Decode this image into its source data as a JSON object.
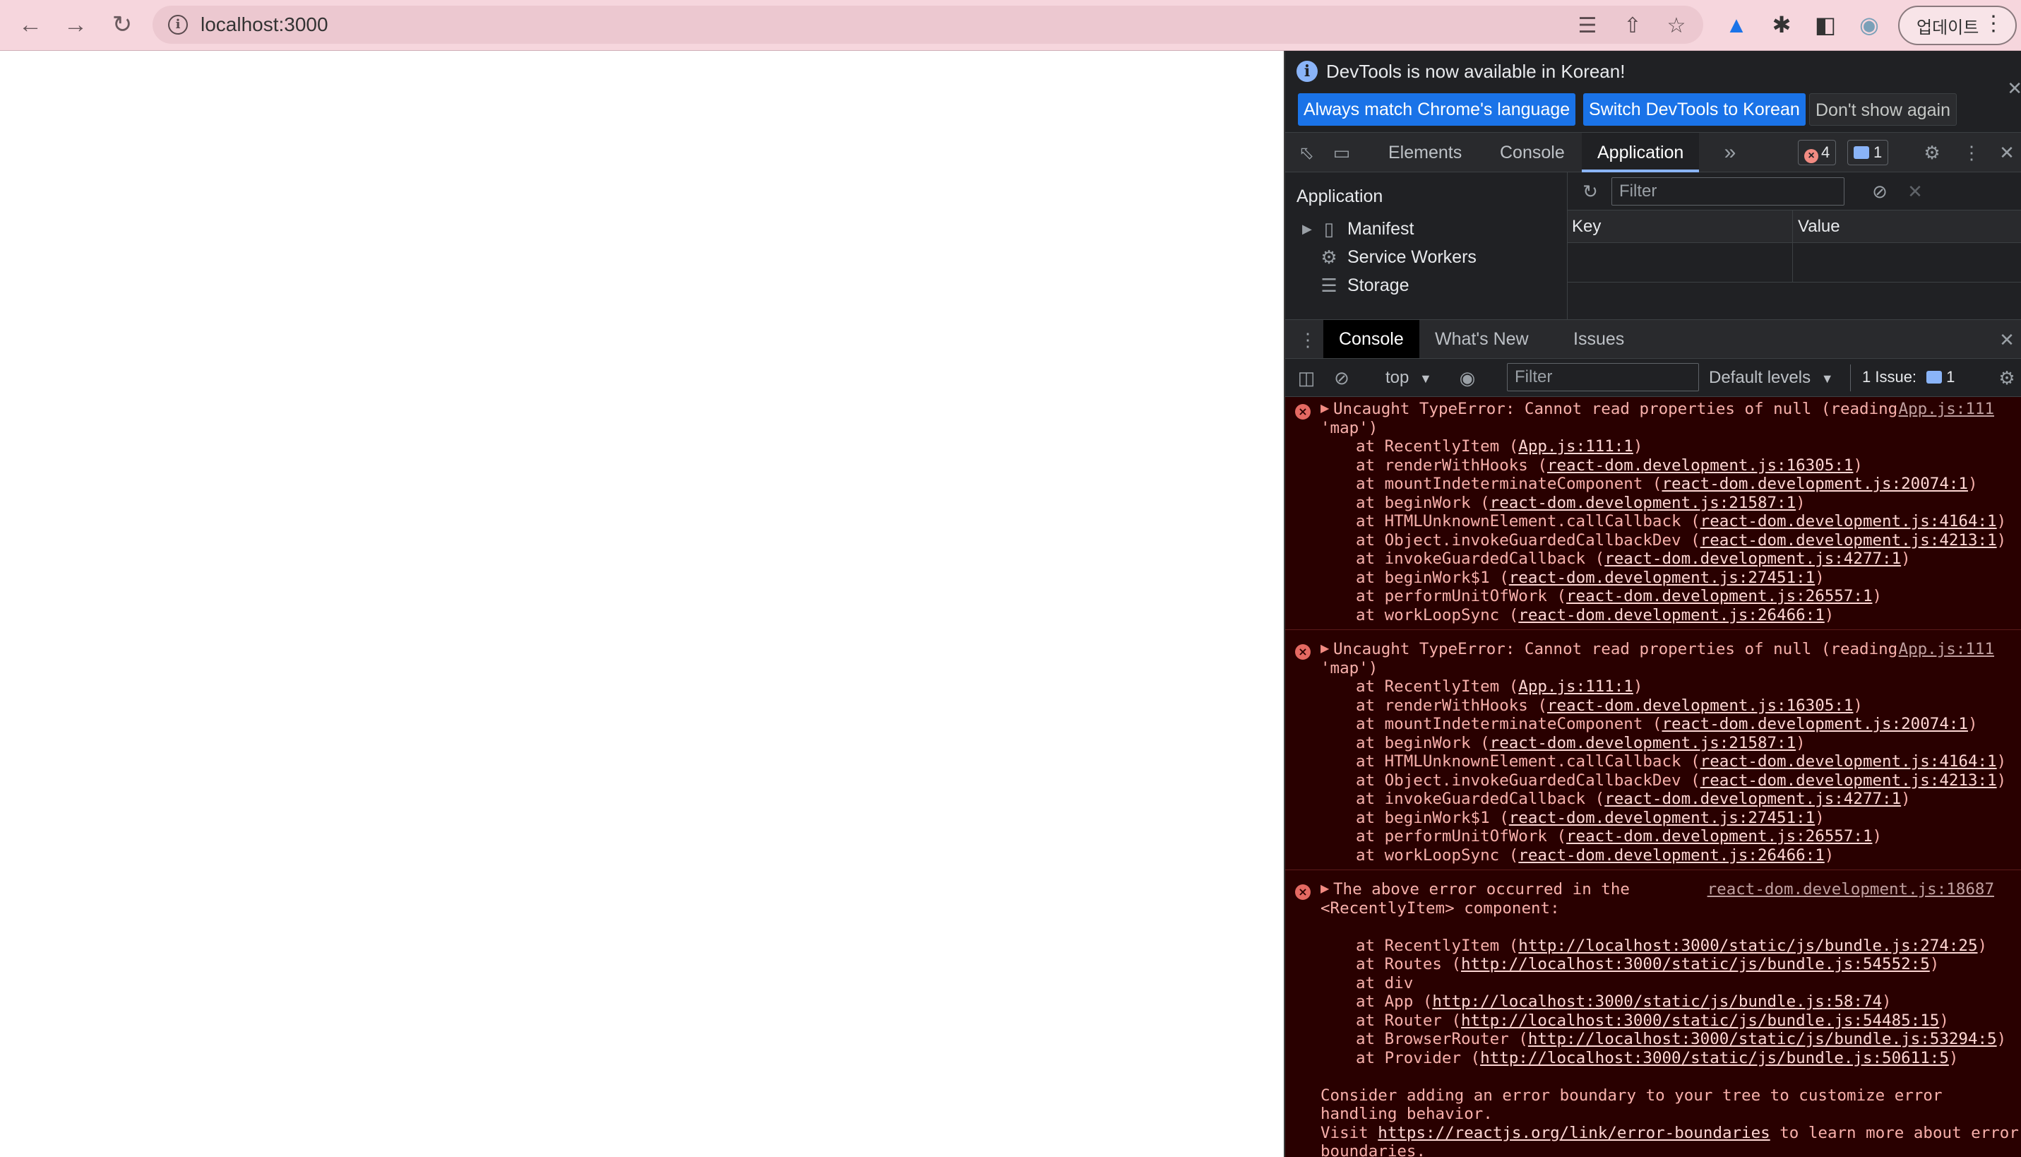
{
  "browser": {
    "url": "localhost:3000",
    "update_label": "업데이트"
  },
  "devtools": {
    "infobar": {
      "message": "DevTools is now available in Korean!",
      "btn_match": "Always match Chrome's language",
      "btn_switch": "Switch DevTools to Korean",
      "btn_dismiss": "Don't show again"
    },
    "tabs": [
      "Elements",
      "Console",
      "Application"
    ],
    "more_tabs": "»",
    "error_count": "4",
    "message_count": "1",
    "application": {
      "title": "Application",
      "items": [
        "Manifest",
        "Service Workers",
        "Storage"
      ],
      "filter_placeholder": "Filter",
      "col_key": "Key",
      "col_value": "Value"
    },
    "drawer_tabs": [
      "Console",
      "What's New",
      "Issues"
    ],
    "console_toolbar": {
      "context": "top",
      "filter_placeholder": "Filter",
      "levels": "Default levels",
      "issues_label": "1 Issue:",
      "issues_count": "1"
    },
    "messages": [
      {
        "head": "Uncaught TypeError: Cannot read properties of null (reading",
        "head2": "'map')",
        "source": "App.js:111",
        "stack": [
          {
            "fn": "RecentlyItem",
            "loc": "App.js:111:1"
          },
          {
            "fn": "renderWithHooks",
            "loc": "react-dom.development.js:16305:1"
          },
          {
            "fn": "mountIndeterminateComponent",
            "loc": "react-dom.development.js:20074:1"
          },
          {
            "fn": "beginWork",
            "loc": "react-dom.development.js:21587:1"
          },
          {
            "fn": "HTMLUnknownElement.callCallback",
            "loc": "react-dom.development.js:4164:1"
          },
          {
            "fn": "Object.invokeGuardedCallbackDev",
            "loc": "react-dom.development.js:4213:1"
          },
          {
            "fn": "invokeGuardedCallback",
            "loc": "react-dom.development.js:4277:1"
          },
          {
            "fn": "beginWork$1",
            "loc": "react-dom.development.js:27451:1"
          },
          {
            "fn": "performUnitOfWork",
            "loc": "react-dom.development.js:26557:1"
          },
          {
            "fn": "workLoopSync",
            "loc": "react-dom.development.js:26466:1"
          }
        ]
      },
      {
        "head": "Uncaught TypeError: Cannot read properties of null (reading",
        "head2": "'map')",
        "source": "App.js:111",
        "stack": [
          {
            "fn": "RecentlyItem",
            "loc": "App.js:111:1"
          },
          {
            "fn": "renderWithHooks",
            "loc": "react-dom.development.js:16305:1"
          },
          {
            "fn": "mountIndeterminateComponent",
            "loc": "react-dom.development.js:20074:1"
          },
          {
            "fn": "beginWork",
            "loc": "react-dom.development.js:21587:1"
          },
          {
            "fn": "HTMLUnknownElement.callCallback",
            "loc": "react-dom.development.js:4164:1"
          },
          {
            "fn": "Object.invokeGuardedCallbackDev",
            "loc": "react-dom.development.js:4213:1"
          },
          {
            "fn": "invokeGuardedCallback",
            "loc": "react-dom.development.js:4277:1"
          },
          {
            "fn": "beginWork$1",
            "loc": "react-dom.development.js:27451:1"
          },
          {
            "fn": "performUnitOfWork",
            "loc": "react-dom.development.js:26557:1"
          },
          {
            "fn": "workLoopSync",
            "loc": "react-dom.development.js:26466:1"
          }
        ]
      }
    ],
    "boundary_message": {
      "head": "The above error occurred in the",
      "head2": "<RecentlyItem> component:",
      "source": "react-dom.development.js:18687",
      "stack": [
        {
          "fn": "RecentlyItem",
          "loc": "http://localhost:3000/static/js/bundle.js:274:25"
        },
        {
          "fn": "Routes",
          "loc": "http://localhost:3000/static/js/bundle.js:54552:5"
        },
        {
          "fn": "div",
          "loc": ""
        },
        {
          "fn": "App",
          "loc": "http://localhost:3000/static/js/bundle.js:58:74"
        },
        {
          "fn": "Router",
          "loc": "http://localhost:3000/static/js/bundle.js:54485:15"
        },
        {
          "fn": "BrowserRouter",
          "loc": "http://localhost:3000/static/js/bundle.js:53294:5"
        },
        {
          "fn": "Provider",
          "loc": "http://localhost:3000/static/js/bundle.js:50611:5"
        }
      ],
      "footer1": "Consider adding an error boundary to your tree to customize error",
      "footer2": "handling behavior.",
      "footer3_pre": "Visit ",
      "footer3_link": "https://reactjs.org/link/error-boundaries",
      "footer3_post": " to learn more about error",
      "footer4": "boundaries."
    }
  }
}
